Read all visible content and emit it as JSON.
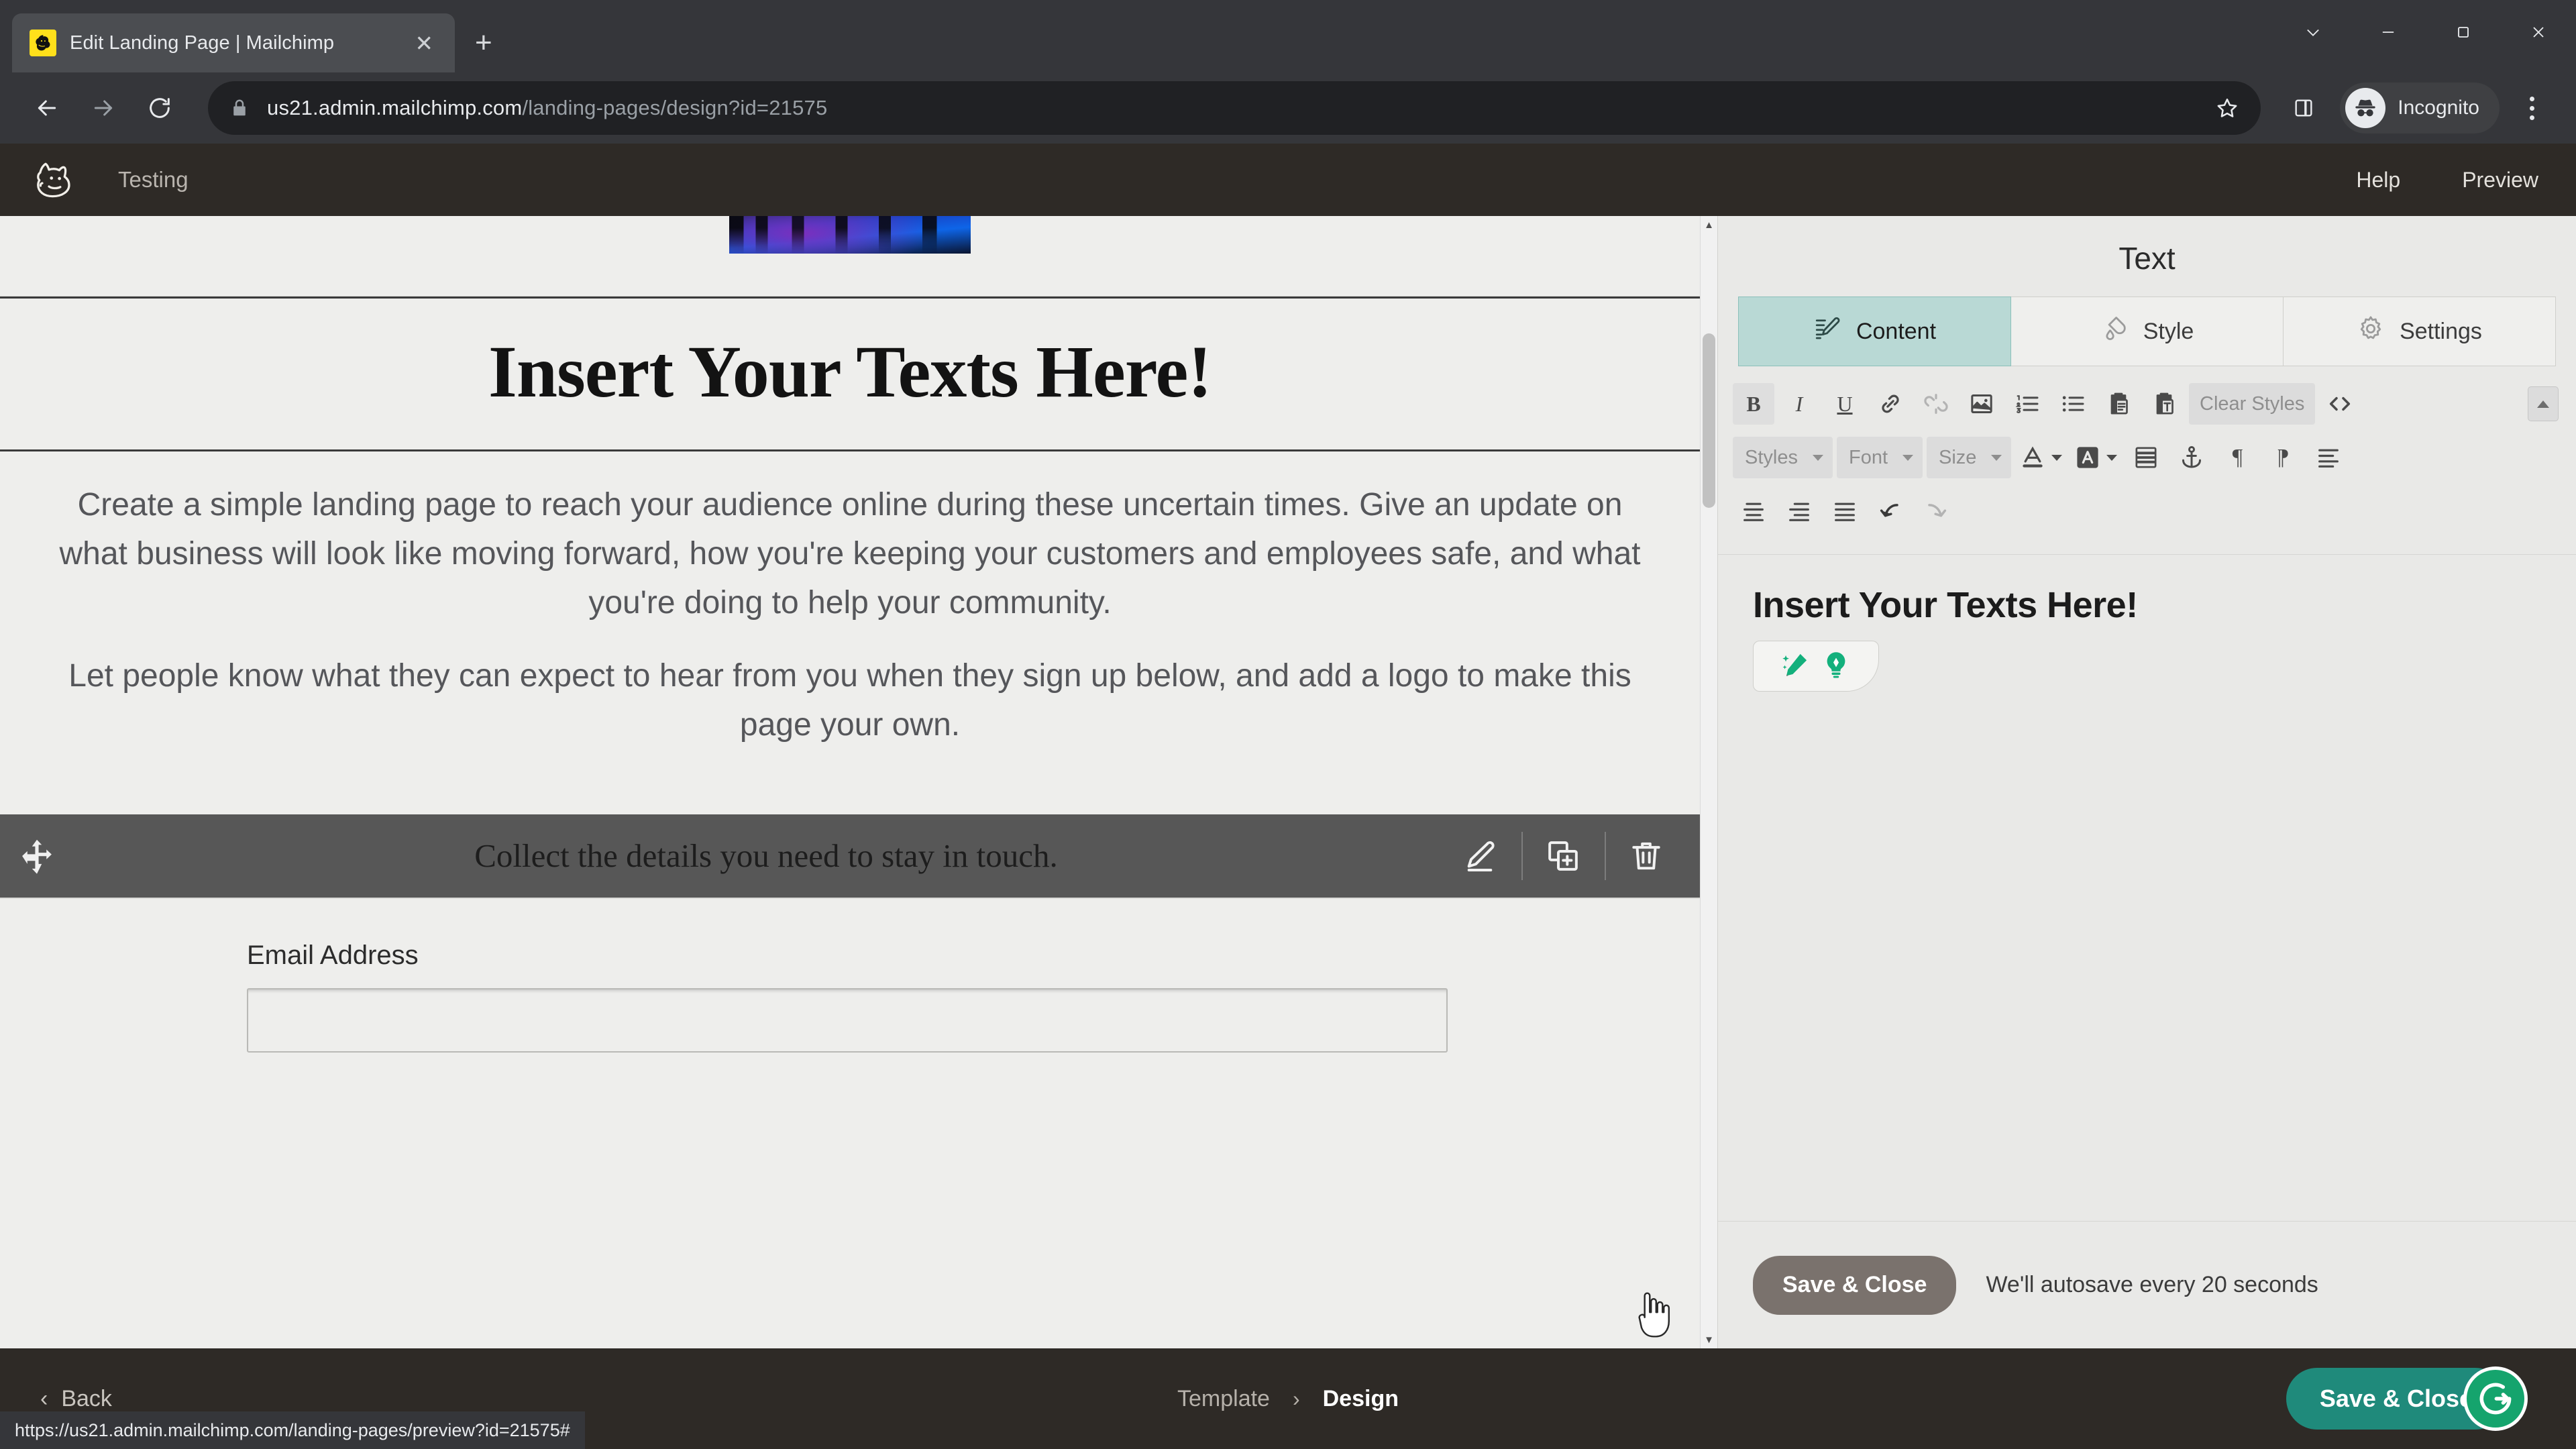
{
  "browser": {
    "tab": {
      "title": "Edit Landing Page | Mailchimp",
      "favicon_icon": "mailchimp-favicon",
      "close_icon": "close-icon"
    },
    "new_tab_icon": "plus-icon",
    "window_controls": {
      "minimize_icon": "chevron-down-icon",
      "minimize2_icon": "minimize-icon",
      "maximize_icon": "maximize-icon",
      "close_icon": "window-close-icon"
    },
    "nav": {
      "back_icon": "arrow-left-icon",
      "forward_icon": "arrow-right-icon",
      "reload_icon": "reload-icon"
    },
    "omnibox": {
      "lock_icon": "lock-icon",
      "url_host": "us21.admin.mailchimp.com",
      "url_path": "/landing-pages/design?id=21575",
      "bookmark_icon": "star-icon"
    },
    "side_panel_icon": "side-panel-icon",
    "profile": {
      "icon": "incognito-icon",
      "label": "Incognito"
    },
    "menu_icon": "kebab-menu-icon",
    "status_link": "https://us21.admin.mailchimp.com/landing-pages/preview?id=21575#"
  },
  "app_header": {
    "logo_icon": "mailchimp-freddie-logo",
    "project_name": "Testing",
    "help_label": "Help",
    "preview_label": "Preview"
  },
  "canvas": {
    "image_block": {
      "icon": "image-thumbnail"
    },
    "heading": "Insert Your Texts Here!",
    "paragraphs": [
      "Create a simple landing page to reach your audience online during these uncertain times. Give an update on what business will look like moving forward, how you're keeping your customers and employees safe, and what you're doing to help your community.",
      "Let people know what they can expect to hear from you when they sign up below, and add a logo to make this page your own."
    ],
    "hover_block": {
      "drag_icon": "move-handle-icon",
      "text": "Collect the details you need to stay in touch.",
      "actions": [
        {
          "name": "edit-block-button",
          "icon": "pencil-icon"
        },
        {
          "name": "duplicate-block-button",
          "icon": "duplicate-icon"
        },
        {
          "name": "delete-block-button",
          "icon": "trash-icon"
        }
      ]
    },
    "form": {
      "email_label": "Email Address",
      "email_value": "",
      "email_placeholder": ""
    },
    "scrollbar": {
      "up_icon": "scroll-up-arrow",
      "down_icon": "scroll-down-arrow"
    }
  },
  "panel": {
    "title": "Text",
    "tabs": [
      {
        "label": "Content",
        "icon": "content-edit-icon",
        "active": true
      },
      {
        "label": "Style",
        "icon": "paint-drop-icon",
        "active": false
      },
      {
        "label": "Settings",
        "icon": "gear-icon",
        "active": false
      }
    ],
    "toolbar_row1": [
      {
        "name": "bold-button",
        "icon": "bold-icon",
        "label": "B",
        "state": "filled"
      },
      {
        "name": "italic-button",
        "icon": "italic-icon",
        "label": "I",
        "state": "normal"
      },
      {
        "name": "underline-button",
        "icon": "underline-icon",
        "label": "U",
        "state": "normal"
      },
      {
        "name": "link-button",
        "icon": "link-icon",
        "label": "",
        "state": "normal"
      },
      {
        "name": "unlink-button",
        "icon": "unlink-icon",
        "label": "",
        "state": "disabled"
      },
      {
        "name": "insert-image-button",
        "icon": "image-icon",
        "label": "",
        "state": "normal"
      },
      {
        "name": "numbered-list-button",
        "icon": "numbered-list-icon",
        "label": "",
        "state": "normal"
      },
      {
        "name": "bullet-list-button",
        "icon": "bullet-list-icon",
        "label": "",
        "state": "normal"
      },
      {
        "name": "paste-button",
        "icon": "paste-icon",
        "label": "",
        "state": "normal"
      },
      {
        "name": "paste-as-text-button",
        "icon": "paste-text-icon",
        "label": "",
        "state": "normal"
      }
    ],
    "clear_styles_label": "Clear Styles",
    "code_view_icon": "code-brackets-icon",
    "collapse_toolbar_icon": "collapse-toolbar-icon",
    "toolbar_selects": [
      {
        "name": "styles-select",
        "label": "Styles"
      },
      {
        "name": "font-select",
        "label": "Font"
      },
      {
        "name": "size-select",
        "label": "Size"
      }
    ],
    "toolbar_row2_icons": [
      {
        "name": "text-color-button",
        "icon": "text-color-icon"
      },
      {
        "name": "background-color-button",
        "icon": "highlight-color-icon"
      },
      {
        "name": "insert-table-button",
        "icon": "table-icon"
      },
      {
        "name": "anchor-button",
        "icon": "anchor-icon"
      },
      {
        "name": "paragraph-button",
        "icon": "paragraph-icon"
      },
      {
        "name": "paragraph-rtl-button",
        "icon": "paragraph-rtl-icon"
      },
      {
        "name": "line-height-button",
        "icon": "line-height-icon"
      }
    ],
    "toolbar_row3_icons": [
      {
        "name": "align-left-button",
        "icon": "align-left-icon"
      },
      {
        "name": "align-center-button",
        "icon": "align-center-icon"
      },
      {
        "name": "align-justify-button",
        "icon": "align-justify-icon"
      },
      {
        "name": "undo-button",
        "icon": "undo-icon"
      },
      {
        "name": "redo-button",
        "icon": "redo-icon"
      }
    ],
    "editor_text": "Insert Your Texts Here!",
    "ai_assistant": {
      "magic_icon": "magic-pencil-icon",
      "idea_icon": "lightbulb-icon"
    },
    "save_close_label": "Save & Close",
    "autosave_note": "We'll autosave every 20 seconds"
  },
  "footer": {
    "back_label": "Back",
    "back_icon": "chevron-left-icon",
    "breadcrumb": [
      {
        "label": "Template",
        "active": false
      },
      {
        "label": "Design",
        "active": true
      }
    ],
    "separator": "›",
    "save_close_label": "Save & Close",
    "grammarly_icon": "grammarly-icon"
  },
  "colors": {
    "accent_teal": "#1f8a7b",
    "tab_active_teal": "#b9d9d5",
    "app_dark": "#2e2a26",
    "chrome_dark": "#35363a",
    "grammarly_green": "#15a46d",
    "mailchimp_yellow": "#ffe01b"
  }
}
